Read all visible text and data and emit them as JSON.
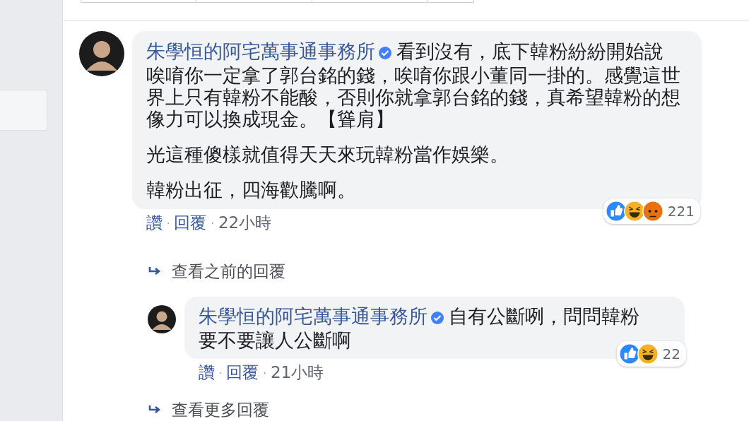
{
  "comments": [
    {
      "author": "朱學恒的阿宅萬事通事務所",
      "verified": true,
      "paragraphs": [
        "看到沒有，底下韓粉紛紛開始說唉唷你一定拿了郭台銘的錢，唉唷你跟小董同一掛的。感覺這世界上只有韓粉不能酸，否則你就拿郭台銘的錢，真希望韓粉的想像力可以換成現金。【聳肩】",
        "光這種傻樣就值得天天來玩韓粉當作娛樂。",
        "韓粉出征，四海歡騰啊。"
      ],
      "actions": [
        "讚",
        "回覆"
      ],
      "separator": "·",
      "time": "22小時",
      "reactions": [
        {
          "kind": "like"
        },
        {
          "kind": "haha"
        },
        {
          "kind": "angry"
        }
      ],
      "reaction_count": "221",
      "more_link": "查看之前的回覆",
      "replies": [
        {
          "author": "朱學恒的阿宅萬事通事務所",
          "verified": true,
          "paragraphs": [
            "自有公斷咧，問問韓粉要不要讓人公斷啊"
          ],
          "actions": [
            "讚",
            "回覆"
          ],
          "separator": "·",
          "time": "21小時",
          "reactions": [
            {
              "kind": "like"
            },
            {
              "kind": "haha"
            }
          ],
          "reaction_count": "22"
        }
      ],
      "after_link": "查看更多回覆"
    }
  ]
}
